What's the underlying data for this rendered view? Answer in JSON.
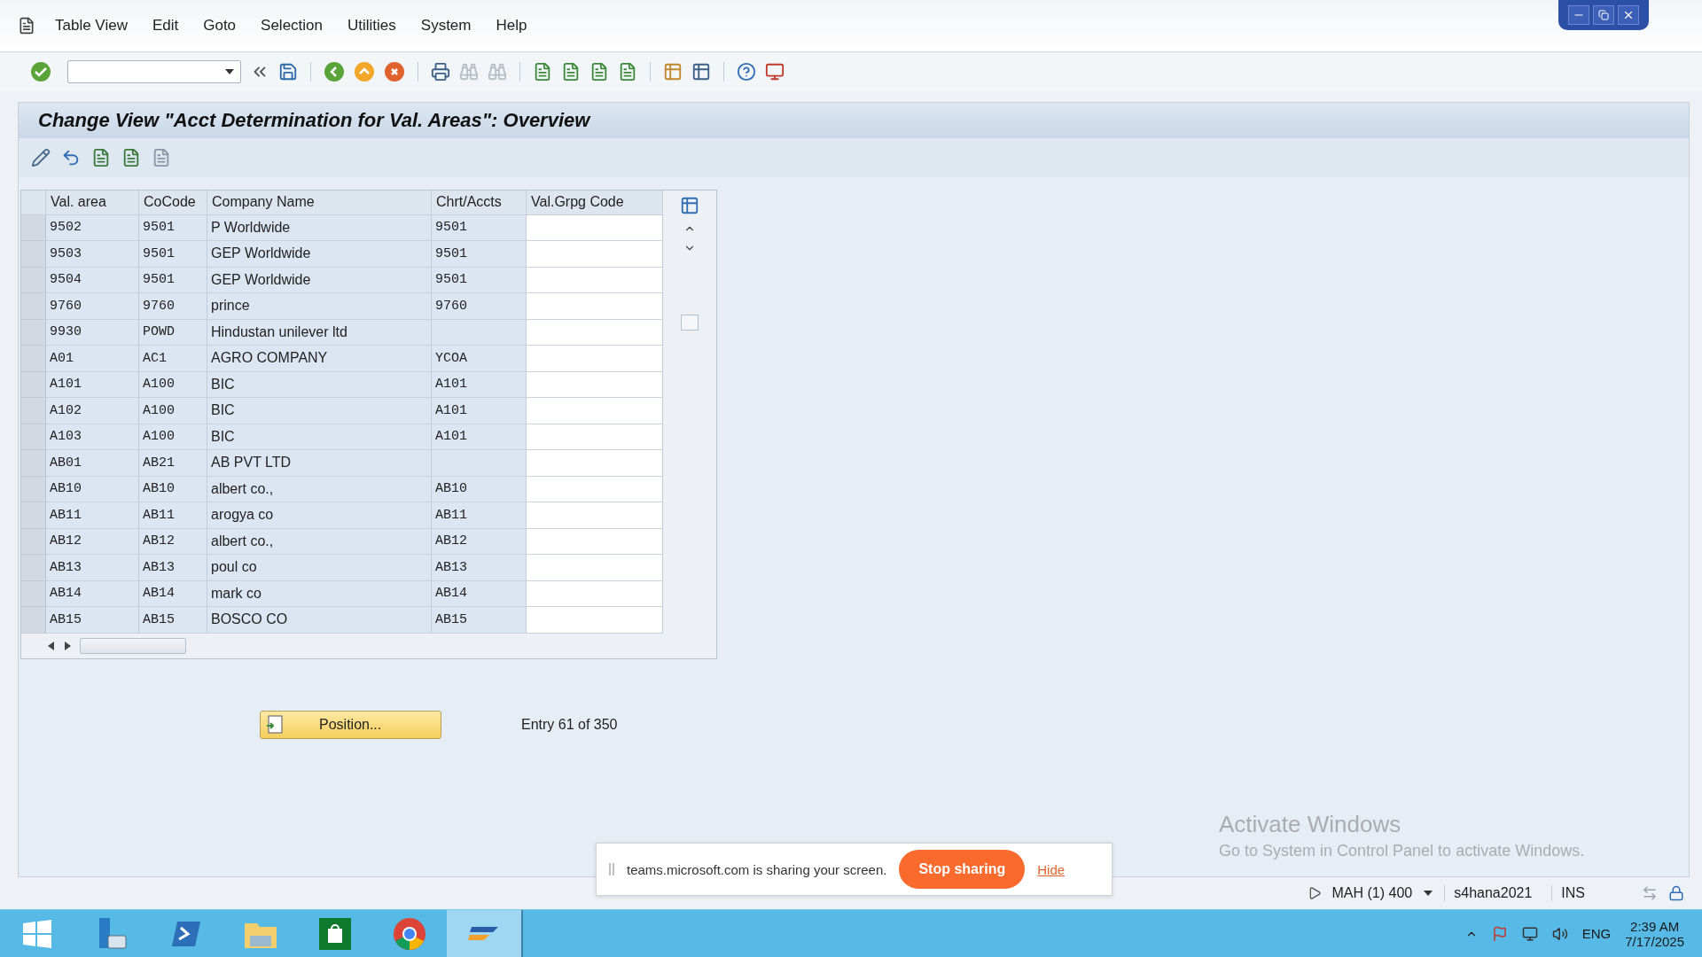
{
  "menu": [
    {
      "label": "Table View"
    },
    {
      "label": "Edit"
    },
    {
      "label": "Goto"
    },
    {
      "label": "Selection"
    },
    {
      "label": "Utilities"
    },
    {
      "label": "System"
    },
    {
      "label": "Help"
    }
  ],
  "title": "Change View \"Acct Determination for Val. Areas\": Overview",
  "table": {
    "columns": [
      {
        "label": "Val. area",
        "kind": "code"
      },
      {
        "label": "CoCode",
        "kind": "code"
      },
      {
        "label": "Company Name",
        "kind": "text"
      },
      {
        "label": "Chrt/Accts",
        "kind": "code"
      },
      {
        "label": "Val.Grpg Code",
        "kind": "input"
      }
    ],
    "rows": [
      [
        "9502",
        "9501",
        "P Worldwide",
        "9501",
        ""
      ],
      [
        "9503",
        "9501",
        "GEP Worldwide",
        "9501",
        ""
      ],
      [
        "9504",
        "9501",
        "GEP Worldwide",
        "9501",
        ""
      ],
      [
        "9760",
        "9760",
        "prince",
        "9760",
        ""
      ],
      [
        "9930",
        "POWD",
        "Hindustan unilever ltd",
        "",
        ""
      ],
      [
        "A01",
        "AC1",
        "AGRO COMPANY",
        "YCOA",
        ""
      ],
      [
        "A101",
        "A100",
        "BIC",
        "A101",
        ""
      ],
      [
        "A102",
        "A100",
        "BIC",
        "A101",
        ""
      ],
      [
        "A103",
        "A100",
        "BIC",
        "A101",
        ""
      ],
      [
        "AB01",
        "AB21",
        "AB PVT LTD",
        "",
        ""
      ],
      [
        "AB10",
        "AB10",
        "albert co.,",
        "AB10",
        ""
      ],
      [
        "AB11",
        "AB11",
        "arogya co",
        "AB11",
        ""
      ],
      [
        "AB12",
        "AB12",
        "albert co.,",
        "AB12",
        ""
      ],
      [
        "AB13",
        "AB13",
        "poul co",
        "AB13",
        ""
      ],
      [
        "AB14",
        "AB14",
        "mark co",
        "AB14",
        ""
      ],
      [
        "AB15",
        "AB15",
        "BOSCO CO",
        "AB15",
        ""
      ]
    ]
  },
  "position_button": "Position...",
  "entry_info": "Entry 61 of 350",
  "status_bar": {
    "session": "MAH (1) 400",
    "server": "s4hana2021",
    "mode": "INS"
  },
  "sharing_banner": {
    "message": "teams.microsoft.com is sharing your screen.",
    "stop": "Stop sharing",
    "hide": "Hide"
  },
  "activation_notice": {
    "title": "Activate Windows",
    "text": "Go to System in Control Panel to activate Windows."
  },
  "taskbar": {
    "apps": [
      {
        "kind": "start",
        "selected": false
      },
      {
        "kind": "server",
        "selected": false
      },
      {
        "kind": "shell",
        "selected": false
      },
      {
        "kind": "folder",
        "selected": false
      },
      {
        "kind": "store",
        "selected": false
      },
      {
        "kind": "browser",
        "selected": false
      },
      {
        "kind": "sap",
        "selected": true
      }
    ],
    "language": "ENG",
    "time": "2:39 AM",
    "date": "7/17/2025"
  }
}
